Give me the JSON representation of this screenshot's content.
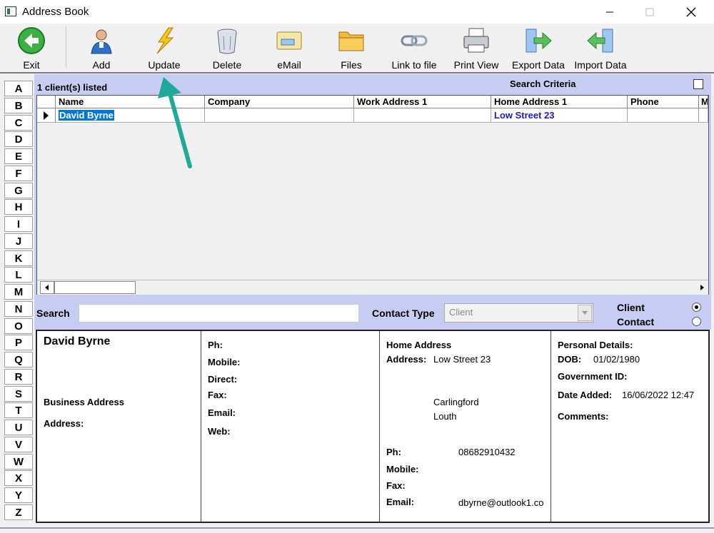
{
  "window": {
    "title": "Address Book"
  },
  "toolbar": {
    "exit": "Exit",
    "add": "Add",
    "update": "Update",
    "delete": "Delete",
    "email": "eMail",
    "files": "Files",
    "link": "Link to file",
    "print": "Print View",
    "export": "Export Data",
    "import": "Import Data"
  },
  "alphabet": [
    "A",
    "B",
    "C",
    "D",
    "E",
    "F",
    "G",
    "H",
    "I",
    "J",
    "K",
    "L",
    "M",
    "N",
    "O",
    "P",
    "Q",
    "R",
    "S",
    "T",
    "U",
    "V",
    "W",
    "X",
    "Y",
    "Z"
  ],
  "list": {
    "count_label": "1 client(s) listed",
    "search_criteria": "Search Criteria",
    "columns": [
      "Name",
      "Company",
      "Work Address 1",
      "Home Address 1",
      "Phone",
      "M"
    ],
    "rows": [
      {
        "name": "David  Byrne",
        "company": "",
        "work": "",
        "home": "Low Street 23",
        "phone": "",
        "m": ""
      }
    ]
  },
  "search": {
    "label": "Search",
    "value": ""
  },
  "contact_type": {
    "label": "Contact Type",
    "placeholder": "Client",
    "options": [
      "Client",
      "Contact"
    ],
    "selected": "Client"
  },
  "detail": {
    "name": "David  Byrne",
    "business_address": "Business Address",
    "address_label": "Address:",
    "ph": "Ph:",
    "mobile": "Mobile:",
    "direct": "Direct:",
    "fax": "Fax:",
    "email": "Email:",
    "web": "Web:",
    "home": {
      "title": "Home Address",
      "address_label": "Address:",
      "address_line1": "Low Street 23",
      "address_line2": "Carlingford",
      "address_line3": "Louth",
      "ph_label": "Ph:",
      "ph_value": "08682910432",
      "mobile_label": "Mobile:",
      "fax_label": "Fax:",
      "email_label": "Email:",
      "email_value": "dbyrne@outlook1.co"
    },
    "personal": {
      "title": "Personal Details:",
      "dob_label": "DOB:",
      "dob_value": "01/02/1980",
      "gov_label": "Government ID:",
      "date_added_label": "Date Added:",
      "date_added_value": "16/06/2022 12:47",
      "comments_label": "Comments:"
    }
  },
  "colors": {
    "panel": "#c7cdf2",
    "link_blue": "#1a1acc",
    "selection": "#0078d7",
    "arrow": "#1ea99a"
  }
}
